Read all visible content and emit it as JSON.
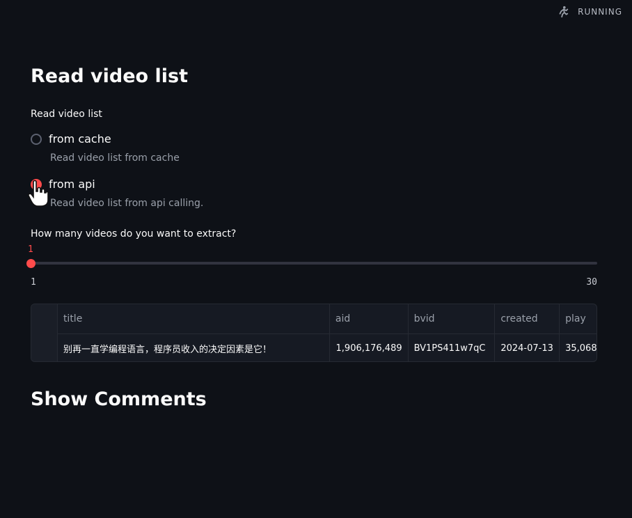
{
  "status": {
    "text": "RUNNING",
    "icon": "running-man-icon"
  },
  "section1": {
    "title": "Read video list"
  },
  "radio_group": {
    "label": "Read video list",
    "options": [
      {
        "label": "from cache",
        "caption": "Read video list from cache",
        "selected": false
      },
      {
        "label": "from api",
        "caption": "Read video list from api calling.",
        "selected": true
      }
    ]
  },
  "slider": {
    "label": "How many videos do you want to extract?",
    "value": "1",
    "min": "1",
    "max": "30",
    "current": 1,
    "accent": "#ff4b4b"
  },
  "table": {
    "columns": [
      "",
      "title",
      "aid",
      "bvid",
      "created",
      "play"
    ],
    "rows": [
      {
        "index": "",
        "title": "别再一直学编程语言，程序员收入的决定因素是它！",
        "aid": "1,906,176,489",
        "bvid": "BV1PS411w7qC",
        "created": "2024-07-13",
        "play": "35,068"
      }
    ]
  },
  "section2": {
    "title": "Show Comments"
  },
  "colors": {
    "background": "#0e1117",
    "accent": "#ff4b4b",
    "text": "#fafafa",
    "muted": "#9aa0aa"
  }
}
